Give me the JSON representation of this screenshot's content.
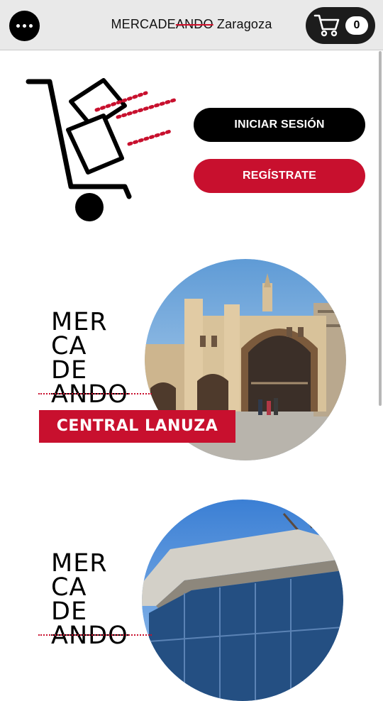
{
  "header": {
    "title_prefix": "MERCADE",
    "title_struck": "ANDO",
    "title_suffix": " Zaragoza",
    "menu_icon": "more-horizontal-icon",
    "cart_icon": "shopping-cart-icon",
    "cart_count": "0"
  },
  "hero": {
    "logo_icon": "hand-truck-icon",
    "login_label": "INICIAR SESIÓN",
    "register_label": "REGÍSTRATE"
  },
  "markets": [
    {
      "wordmark": [
        "MER",
        "CA",
        "DE",
        "ANDO"
      ],
      "name": "CENTRAL LANUZA"
    },
    {
      "wordmark": [
        "MER",
        "CA",
        "DE",
        "ANDO"
      ]
    }
  ],
  "colors": {
    "accent": "#c8102e",
    "dark": "#000000",
    "header_bg": "#e9e9e9"
  }
}
